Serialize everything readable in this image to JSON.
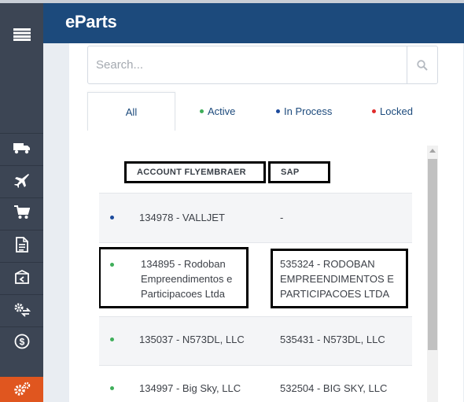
{
  "app": {
    "brand": "eParts"
  },
  "sidebar": {
    "items": [
      {
        "icon": "menu-icon"
      },
      {
        "icon": "truck-icon"
      },
      {
        "icon": "airplane-icon"
      },
      {
        "icon": "cart-icon"
      },
      {
        "icon": "document-icon"
      },
      {
        "icon": "return-box-icon"
      },
      {
        "icon": "gears-exchange-icon"
      },
      {
        "icon": "dollar-circle-icon"
      },
      {
        "icon": "settings-gears-icon",
        "active": true
      }
    ]
  },
  "search": {
    "placeholder": "Search...",
    "value": "",
    "icon": "search-icon"
  },
  "tabs": [
    {
      "label": "All",
      "active": true
    },
    {
      "label": "Active",
      "dot_color": "#3fae5a"
    },
    {
      "label": "In Process",
      "dot_color": "#1c4a9c"
    },
    {
      "label": "Locked",
      "dot_color": "#e02b2b"
    }
  ],
  "table": {
    "columns": [
      "ACCOUNT FLYEMBRAER",
      "SAP"
    ],
    "rows": [
      {
        "status_color": "#1c4a9c",
        "account": "134978 - VALLJET",
        "sap": "-"
      },
      {
        "status_color": "#3fae5a",
        "account": "134895 - Rodoban Empreendimentos e Participacoes Ltda",
        "sap": "535324 - RODOBAN EMPREENDIMENTOS E PARTICIPACOES LTDA"
      },
      {
        "status_color": "#3fae5a",
        "account": "135037 - N573DL, LLC",
        "sap": "535431 - N573DL, LLC"
      },
      {
        "status_color": "#3fae5a",
        "account": "134997 - Big Sky, LLC",
        "sap": "532504 - BIG SKY, LLC"
      }
    ]
  },
  "colors": {
    "header": "#1c4a7c",
    "sidebar": "#3c4554",
    "sidebar_active": "#e0561f"
  }
}
